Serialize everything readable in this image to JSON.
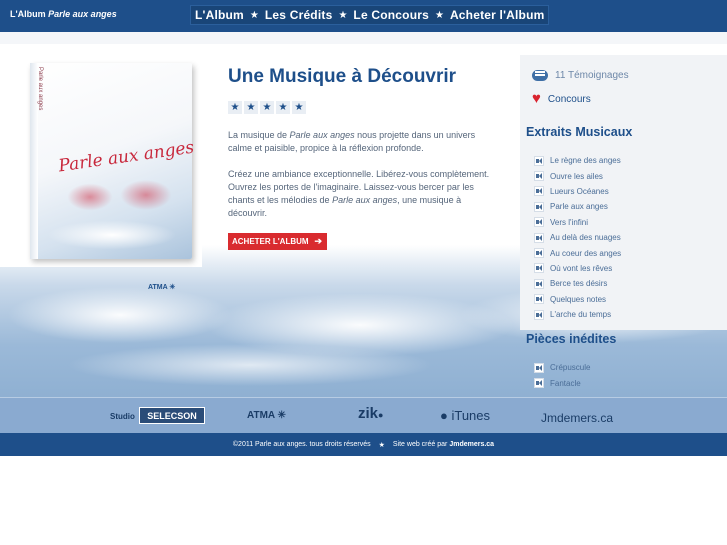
{
  "header": {
    "brand_prefix": "L'Album",
    "brand_title": "Parle aux anges",
    "nav": [
      {
        "label": "L'Album"
      },
      {
        "label": "Les Crédits"
      },
      {
        "label": "Le Concours"
      },
      {
        "label": "Acheter l'Album"
      }
    ]
  },
  "album": {
    "cover_title": "Parle aux anges",
    "spine_text": "Parle aux anges",
    "label_logo": "ATMA"
  },
  "main": {
    "title": "Une Musique à Découvrir",
    "rating": {
      "value": 5,
      "max": 5
    },
    "p1_before": "La musique de ",
    "p1_em": "Parle aux anges",
    "p1_after": " nous projette dans un univers calme et paisible, propice à la réflexion profonde.",
    "p2_before": "Créez une ambiance exceptionnelle. Libérez-vous complètement. Ouvrez les portes de l'imaginaire. Laissez-vous bercer par les chants et les mélodies de ",
    "p2_em": "Parle aux anges",
    "p2_after": ", une musique à découvrir.",
    "buy_label": "ACHETER L'ALBUM"
  },
  "sidebar": {
    "testimonials": "11 Témoignages",
    "concours": "Concours",
    "extraits_title": "Extraits Musicaux",
    "extraits": [
      "Le règne des anges",
      "Ouvre les ailes",
      "Lueurs Océanes",
      "Parle aux anges",
      "Vers l'infini",
      "Au delà des nuages",
      "Au coeur des anges",
      "Où vont les rêves",
      "Berce tes désirs",
      "Quelques notes",
      "L'arche du temps"
    ],
    "inedites_title": "Pièces inédites",
    "inedites": [
      "Crépuscule",
      "Fantacle"
    ]
  },
  "sponsors": {
    "studio": "Studio",
    "selecson": "SELECSON",
    "atma": "ATMA",
    "zik": "zik",
    "itunes": "iTunes",
    "jmdemers": "Jmdemers.ca"
  },
  "footer": {
    "copyright": "©2011 Parle aux anges. tous droits réservés",
    "credit_prefix": "Site web créé par",
    "credit_name": "Jmdemers.ca"
  },
  "colors": {
    "brand_blue": "#1e4f8a",
    "accent_red": "#d92b2f"
  }
}
